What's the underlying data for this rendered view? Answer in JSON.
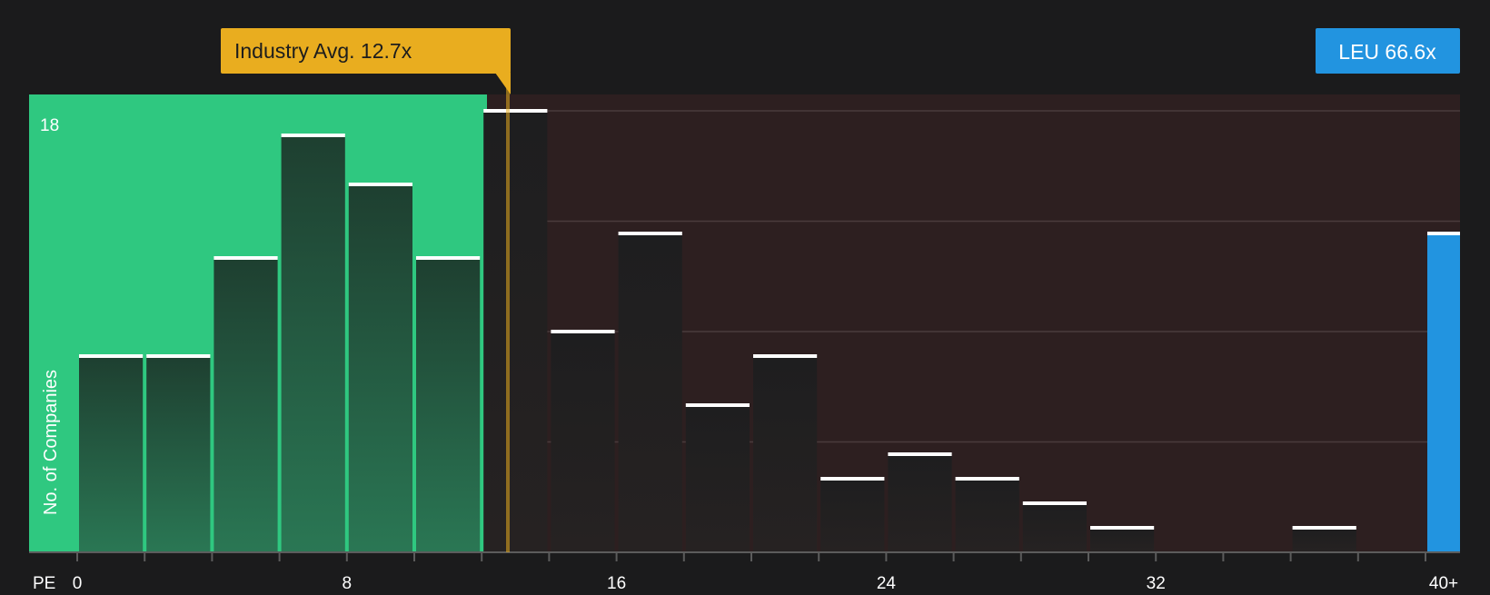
{
  "chart_data": {
    "type": "bar",
    "xlabel": "PE",
    "ylabel": "No. of Companies",
    "y_tick_label": "18",
    "x_tick_labels": [
      "0",
      "8",
      "16",
      "24",
      "32",
      "40+"
    ],
    "bin_width": 2,
    "ylim": [
      0,
      18
    ],
    "bins": [
      {
        "x_start": 0,
        "value": 8
      },
      {
        "x_start": 2,
        "value": 8
      },
      {
        "x_start": 4,
        "value": 12
      },
      {
        "x_start": 6,
        "value": 17
      },
      {
        "x_start": 8,
        "value": 15
      },
      {
        "x_start": 10,
        "value": 12
      },
      {
        "x_start": 12,
        "value": 18
      },
      {
        "x_start": 14,
        "value": 9
      },
      {
        "x_start": 16,
        "value": 13
      },
      {
        "x_start": 18,
        "value": 6
      },
      {
        "x_start": 20,
        "value": 8
      },
      {
        "x_start": 22,
        "value": 3
      },
      {
        "x_start": 24,
        "value": 4
      },
      {
        "x_start": 26,
        "value": 3
      },
      {
        "x_start": 28,
        "value": 2
      },
      {
        "x_start": 30,
        "value": 1
      },
      {
        "x_start": 36,
        "value": 1
      }
    ],
    "industry_avg": {
      "label": "Industry Avg. 12.7x",
      "value": 12.7
    },
    "company": {
      "label": "LEU 66.6x",
      "value": 66.6,
      "bar_value": 13,
      "bin": "40+"
    },
    "colors": {
      "background": "#1b1b1c",
      "below_avg_zone": "#2fc880",
      "above_avg_zone": "#2d1f20",
      "industry_avg": "#e9ad1f",
      "company": "#2294e0",
      "bar_cap": "#ffffff"
    }
  }
}
